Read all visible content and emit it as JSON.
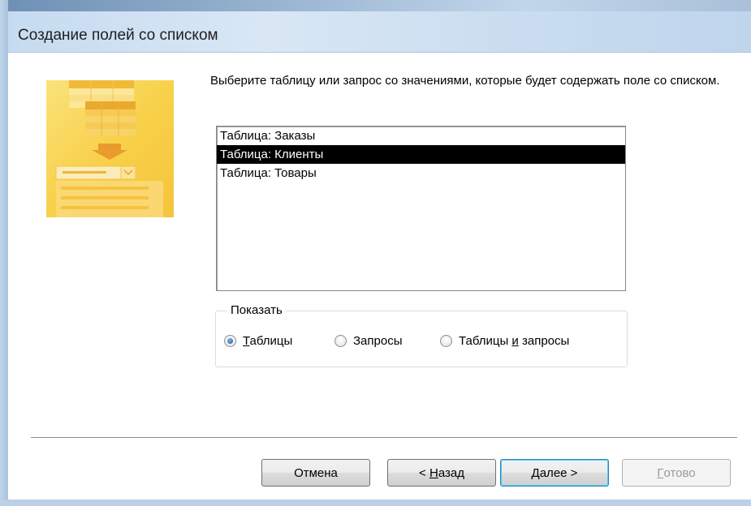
{
  "window": {
    "title": "Создание полей со списком"
  },
  "instruction": "Выберите таблицу или запрос со значениями, которые будет содержать поле со списком.",
  "list": {
    "items": [
      {
        "label": "Таблица: Заказы",
        "selected": false
      },
      {
        "label": "Таблица: Клиенты",
        "selected": true
      },
      {
        "label": "Таблица: Товары",
        "selected": false
      }
    ]
  },
  "show_group": {
    "label": "Показать",
    "options": {
      "tables": {
        "pre": "",
        "key": "Т",
        "post": "аблицы",
        "checked": true
      },
      "queries": {
        "pre": "",
        "key": "",
        "post": "Запросы",
        "checked": false
      },
      "both": {
        "pre": "Таблицы ",
        "key": "и",
        "post": " запросы",
        "checked": false
      }
    }
  },
  "buttons": {
    "cancel": {
      "pre": "Отмена",
      "key": "",
      "post": ""
    },
    "back": {
      "pre": "< ",
      "key": "Н",
      "post": "азад"
    },
    "next": {
      "pre": "",
      "key": "Д",
      "post": "алее >"
    },
    "finish": {
      "pre": "",
      "key": "Г",
      "post": "отово"
    }
  },
  "colors": {
    "selection": "#000000",
    "wizard_art": "#f8d14a"
  }
}
